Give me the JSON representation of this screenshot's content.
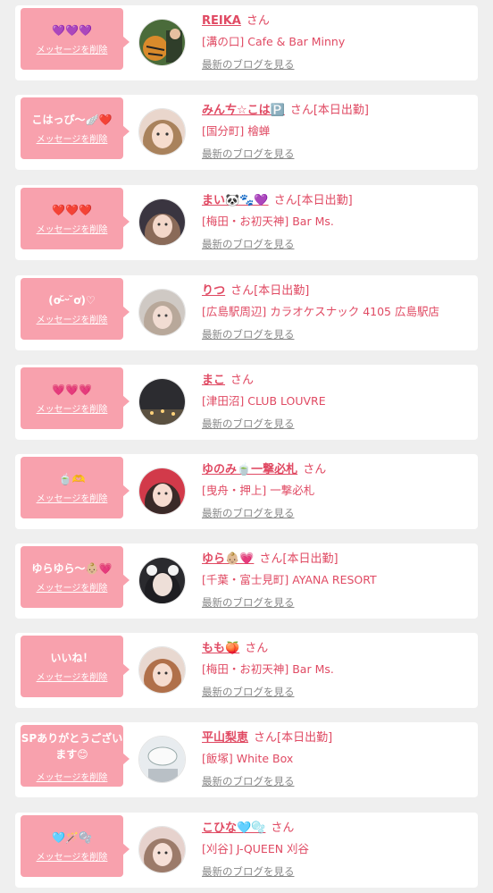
{
  "delete_label": "メッセージを削除",
  "blog_label": "最新のブログを見る",
  "colors": {
    "bubble": "#f8a1ad",
    "accent": "#e04a63",
    "background": "#efefef"
  },
  "items": [
    {
      "message": "💜💜💜",
      "name": "REIKA",
      "suffix": "さん",
      "status": "",
      "place": "[溝の口] Cafe & Bar Minny",
      "avatar_icon": "tiger-photo-icon"
    },
    {
      "message": "こはっぴ〜🪽❤️",
      "name": "みんㄘ☆こは🅿️",
      "suffix": "さん",
      "status": "[本日出勤]",
      "place": "[国分町] 檜蝉",
      "avatar_icon": "woman-photo-icon"
    },
    {
      "message": "❤️❤️❤️",
      "name": "まい🐼🐾💜",
      "suffix": "さん",
      "status": "[本日出勤]",
      "place": "[梅田・お初天神] Bar Ms.",
      "avatar_icon": "woman-photo-icon"
    },
    {
      "message": "(ơ ̴̆ᵕ ̆ơ)♡",
      "name": "りつ",
      "suffix": "さん",
      "status": "[本日出勤]",
      "place": "[広島駅周辺] カラオケスナック 4105 広島駅店",
      "avatar_icon": "woman-photo-icon"
    },
    {
      "message": "💗💗💗",
      "name": "まこ",
      "suffix": "さん",
      "status": "",
      "place": "[津田沼] CLUB LOUVRE",
      "avatar_icon": "night-view-photo-icon"
    },
    {
      "message": "🍵🫶",
      "name": "ゆのみ🍵一撃必札",
      "suffix": "さん",
      "status": "",
      "place": "[曳舟・押上] 一撃必札",
      "avatar_icon": "woman-photo-icon"
    },
    {
      "message": "ゆらゆら〜👶🏼💗",
      "name": "ゆら👶🏼💗",
      "suffix": "さん",
      "status": "[本日出勤]",
      "place": "[千葉・富士見町] AYANA RESORT",
      "avatar_icon": "woman-photo-icon"
    },
    {
      "message": "いいね！",
      "name": "もも🍑",
      "suffix": "さん",
      "status": "",
      "place": "[梅田・お初天神] Bar Ms.",
      "avatar_icon": "woman-photo-icon"
    },
    {
      "message": "SPありがとうございます😊",
      "name": "平山梨恵",
      "suffix": "さん",
      "status": "[本日出勤]",
      "place": "[飯塚] White Box",
      "avatar_icon": "sign-photo-icon"
    },
    {
      "message": "🩵🪄🫧",
      "name": "こひな🩵🫧",
      "suffix": "さん",
      "status": "",
      "place": "[刈谷] J-QUEEN 刈谷",
      "avatar_icon": "woman-photo-icon"
    }
  ]
}
